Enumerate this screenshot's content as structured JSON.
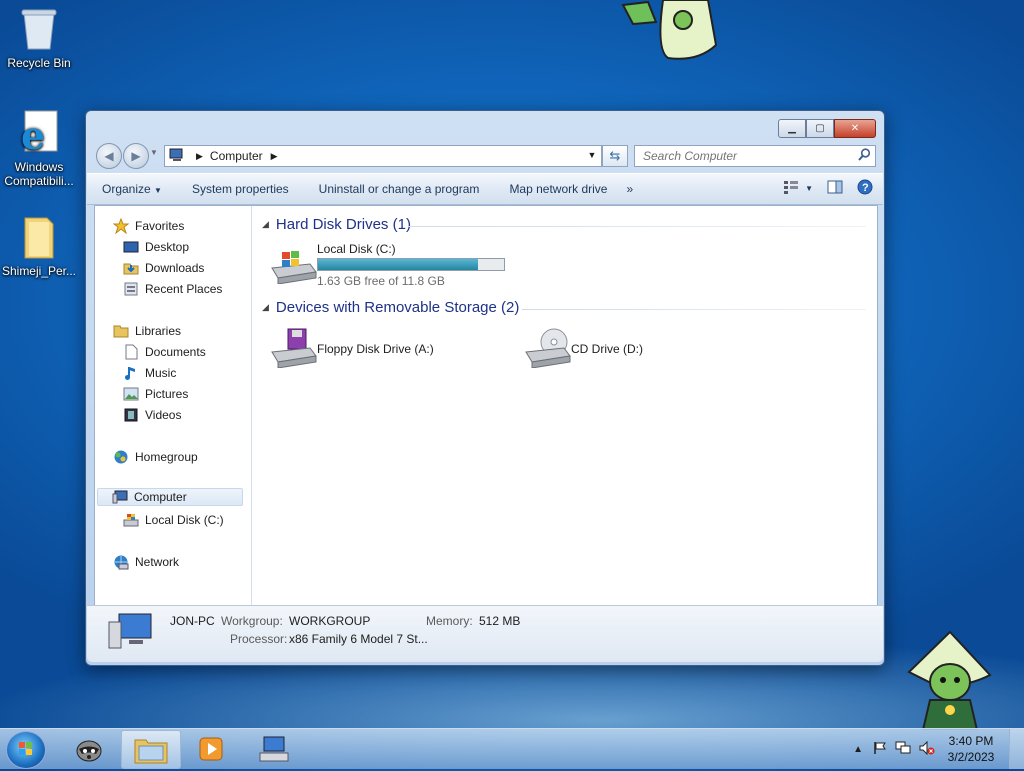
{
  "desktop": {
    "icons": [
      {
        "label": "Recycle Bin"
      },
      {
        "label": "Windows Compatibili..."
      },
      {
        "label": "Shimeji_Per..."
      }
    ]
  },
  "window": {
    "address": {
      "crumb": "Computer"
    },
    "search": {
      "placeholder": "Search Computer"
    },
    "toolbar": {
      "organize": "Organize",
      "system_properties": "System properties",
      "uninstall": "Uninstall or change a program",
      "map_drive": "Map network drive",
      "more": "»"
    },
    "nav": {
      "favorites": "Favorites",
      "desktop": "Desktop",
      "downloads": "Downloads",
      "recent": "Recent Places",
      "libraries": "Libraries",
      "documents": "Documents",
      "music": "Music",
      "pictures": "Pictures",
      "videos": "Videos",
      "homegroup": "Homegroup",
      "computer": "Computer",
      "local_disk": "Local Disk (C:)",
      "network": "Network"
    },
    "groups": {
      "hdd": {
        "title": "Hard Disk Drives (1)",
        "drive_name": "Local Disk (C:)",
        "free_text": "1.63 GB free of 11.8 GB",
        "used_fraction": 0.862
      },
      "removable": {
        "title": "Devices with Removable Storage (2)",
        "floppy": "Floppy Disk Drive (A:)",
        "cd": "CD Drive (D:)"
      }
    },
    "details": {
      "computer_name": "JON-PC",
      "workgroup_label": "Workgroup:",
      "workgroup_value": "WORKGROUP",
      "memory_label": "Memory:",
      "memory_value": "512 MB",
      "processor_label": "Processor:",
      "processor_value": "x86 Family 6 Model 7 St..."
    }
  },
  "taskbar": {
    "time": "3:40 PM",
    "date": "3/2/2023"
  },
  "colors": {
    "accent": "#1e3287",
    "bar_fill": "#25879f",
    "desktop": "#0f63b8"
  }
}
